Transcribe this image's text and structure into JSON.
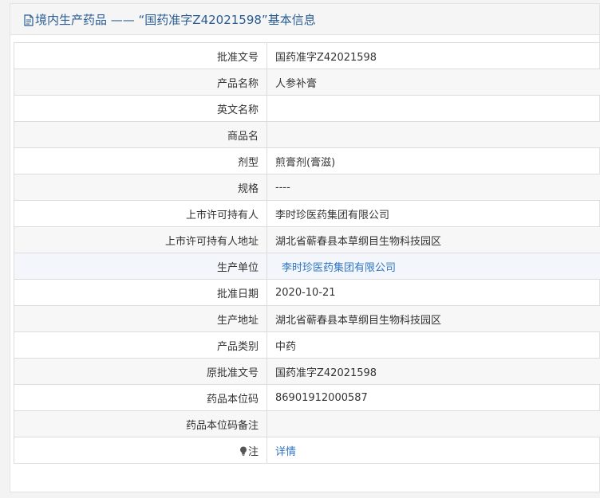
{
  "header": {
    "title": "境内生产药品 —— “国药准字Z42021598”基本信息",
    "icon": "document-icon"
  },
  "rows": [
    {
      "label": "批准文号",
      "value": "国药准字Z42021598"
    },
    {
      "label": "产品名称",
      "value": "人参补膏"
    },
    {
      "label": "英文名称",
      "value": ""
    },
    {
      "label": "商品名",
      "value": ""
    },
    {
      "label": "剂型",
      "value": "煎膏剂(膏滋)"
    },
    {
      "label": "规格",
      "value": "----"
    },
    {
      "label": "上市许可持有人",
      "value": "李时珍医药集团有限公司"
    },
    {
      "label": "上市许可持有人地址",
      "value": "湖北省蕲春县本草纲目生物科技园区"
    },
    {
      "label": "生产单位",
      "value": "李时珍医药集团有限公司"
    },
    {
      "label": "批准日期",
      "value": "2020-10-21"
    },
    {
      "label": "生产地址",
      "value": "湖北省蕲春县本草纲目生物科技园区"
    },
    {
      "label": "产品类别",
      "value": "中药"
    },
    {
      "label": "原批准文号",
      "value": "国药准字Z42021598"
    },
    {
      "label": "药品本位码",
      "value": "86901912000587"
    },
    {
      "label": "药品本位码备注",
      "value": ""
    },
    {
      "label": "注",
      "value": "详情",
      "icon": "lightbulb-icon"
    }
  ],
  "colors": {
    "header_text": "#2a5d93",
    "link": "#2f75c5",
    "border": "#dcdcdc",
    "alt_row": "#f7f7f7",
    "highlight_row": "#f3f6fb"
  }
}
